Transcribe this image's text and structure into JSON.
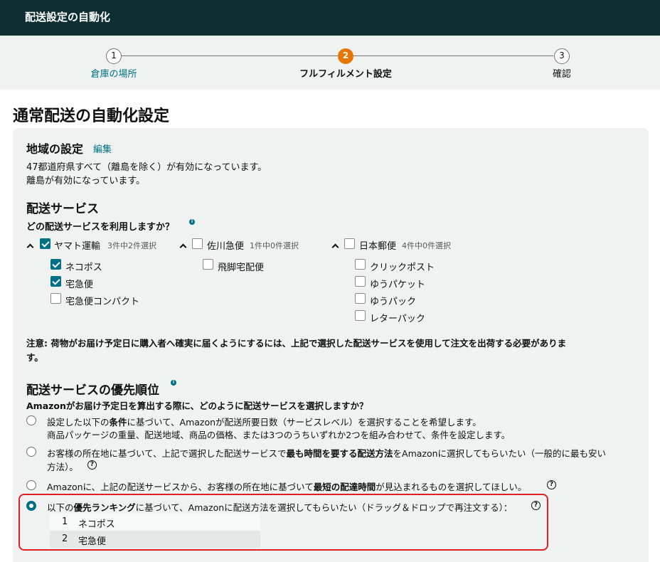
{
  "header": {
    "title": "配送設定の自動化"
  },
  "stepper": {
    "steps": [
      {
        "num": "1",
        "label": "倉庫の場所"
      },
      {
        "num": "2",
        "label": "フルフィルメント設定"
      },
      {
        "num": "3",
        "label": "確認"
      }
    ],
    "active_step": 2
  },
  "page_title": "通常配送の自動化設定",
  "region": {
    "heading": "地域の設定",
    "edit_link": "編集",
    "line1": "47都道府県すべて（離島を除く）が有効になっています。",
    "line2": "離島が有効になっています。"
  },
  "shipping_services": {
    "heading": "配送サービス",
    "question": "どの配送サービスを利用しますか？",
    "carriers": [
      {
        "name": "ヤマト運輸",
        "count": "3件中2件選択",
        "checked": true,
        "services": [
          {
            "label": "ネコポス",
            "checked": true
          },
          {
            "label": "宅急便",
            "checked": true
          },
          {
            "label": "宅急便コンパクト",
            "checked": false
          }
        ]
      },
      {
        "name": "佐川急便",
        "count": "1件中0件選択",
        "checked": false,
        "services": [
          {
            "label": "飛脚宅配便",
            "checked": false
          }
        ]
      },
      {
        "name": "日本郵便",
        "count": "4件中0件選択",
        "checked": false,
        "services": [
          {
            "label": "クリックポスト",
            "checked": false
          },
          {
            "label": "ゆうパケット",
            "checked": false
          },
          {
            "label": "ゆうパック",
            "checked": false
          },
          {
            "label": "レターパック",
            "checked": false
          }
        ]
      }
    ],
    "notice": "注意: 荷物がお届け予定日に購入者へ確実に届くようにするには、上記で選択した配送サービスを使用して注文を出荷する必要がありま",
    "notice_cont": "す。"
  },
  "priority": {
    "heading": "配送サービスの優先順位",
    "question": "Amazonがお届け予定日を算出する際に、どのように配送サービスを選択しますか？",
    "options": [
      {
        "pre": "設定した以下の",
        "bold": "条件",
        "post": "に基づいて、Amazonが配送所要日数（サービスレベル）を選択することを希望します。",
        "line2": "商品パッケージの重量、配送地域、商品の価格、または3つのうちいずれか2つを組み合わせて、条件を設定します。",
        "selected": false
      },
      {
        "pre": "お客様の所在地に基づいて、上記で選択した配送サービスで",
        "bold": "最も時間を要する配送方法",
        "post": "をAmazonに選択してもらいたい（一般的に最も安い",
        "line2": "方法）。",
        "selected": false
      },
      {
        "pre": "Amazonに、上記の配送サービスから、お客様の所在地に基づいて",
        "bold": "最短の配達時間",
        "post": "が見込まれるものを選択してほしい。",
        "selected": false
      },
      {
        "pre": "以下の",
        "bold": "優先ランキング",
        "post": "に基づいて、Amazonに配送方法を選択してもらいたい（ドラッグ＆ドロップで再注文する）：",
        "selected": true
      }
    ],
    "ranking": [
      {
        "rank": "1",
        "service": "ネコポス"
      },
      {
        "rank": "2",
        "service": "宅急便"
      }
    ]
  },
  "colors": {
    "header_bg": "#0d2f33",
    "accent": "#007185",
    "active_step": "#e77600",
    "highlight": "#e02020"
  }
}
